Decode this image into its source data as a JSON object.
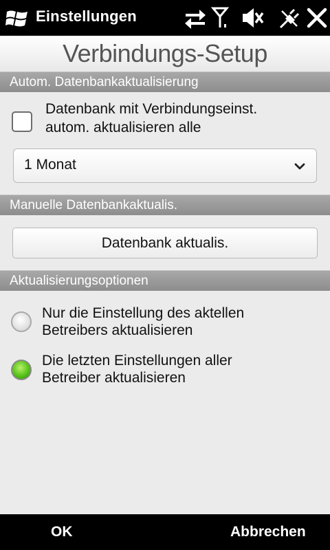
{
  "statusbar": {
    "title": "Einstellungen",
    "icons": [
      "windows-logo-icon",
      "data-transfer-icon",
      "signal-icon",
      "speaker-muted-icon",
      "power-plug-icon",
      "close-icon"
    ]
  },
  "page": {
    "title": "Verbindungs-Setup"
  },
  "sections": {
    "auto": {
      "header": "Autom. Datenbankaktualisierung",
      "checkbox_label_1": "Datenbank mit Verbindungseinst.",
      "checkbox_label_2": "autom. aktualisieren alle",
      "checkbox_checked": false,
      "interval_selected": "1 Monat"
    },
    "manual": {
      "header": "Manuelle Datenbankaktualis.",
      "button_label": "Datenbank aktualis."
    },
    "options": {
      "header": "Aktualisierungsoptionen",
      "option1_line1": "Nur die Einstellung des aktellen",
      "option1_line2": "Betreibers aktualisieren",
      "option1_selected": false,
      "option2_line1": "Die letzten Einstellungen aller",
      "option2_line2": "Betreiber aktualisieren",
      "option2_selected": true
    }
  },
  "softkeys": {
    "left": "OK",
    "right": "Abbrechen"
  },
  "colors": {
    "selected_radio": "#58c21a",
    "section_header": "#9a9a9a"
  }
}
